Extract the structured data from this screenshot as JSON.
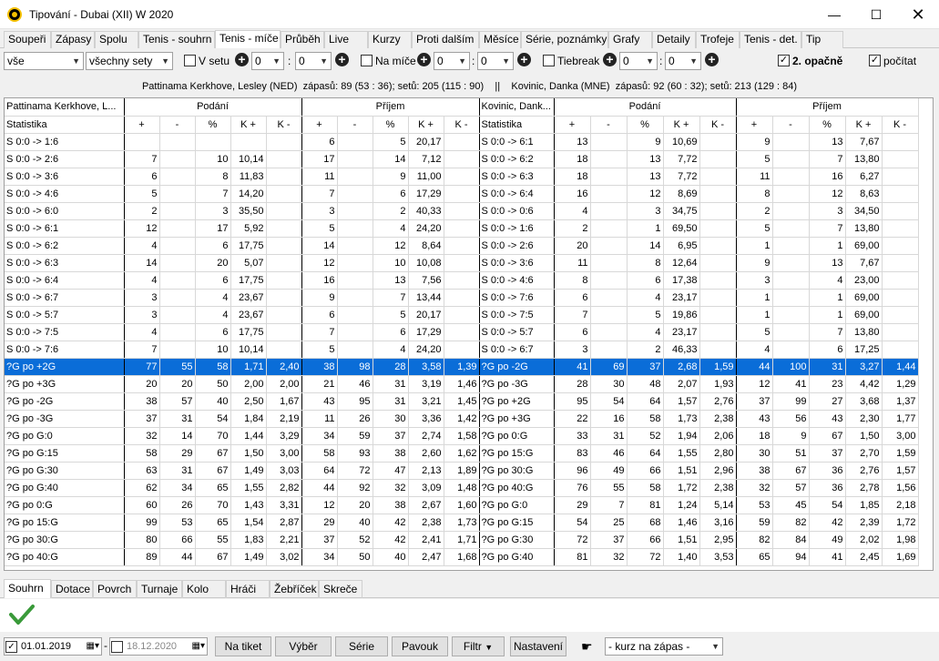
{
  "window": {
    "title": "Tipování - Dubai (XII) W 2020"
  },
  "tabs": [
    "Soupeři",
    "Zápasy",
    "Spolu",
    "Tenis - souhrn",
    "Tenis - míče",
    "Průběh",
    "Live",
    "Kurzy",
    "Proti dalším",
    "Měsíce",
    "Série, poznámky",
    "Grafy",
    "Detaily",
    "Trofeje",
    "Tenis - det.",
    "Tip"
  ],
  "filters": {
    "filter1": "vše",
    "filter2": "všechny sety",
    "v_setu": "V setu",
    "na_mice": "Na míče",
    "tiebreak": "Tiebreak",
    "zero": "0",
    "colon": ":",
    "opacne": "2. opačně",
    "pocitat": "počítat"
  },
  "info": {
    "p1": "Pattinama Kerkhove, Lesley (NED)",
    "p1_stats": "zápasů: 89 (53 : 36);  setů: 205 (115 : 90)",
    "divider": "||",
    "p2": "Kovinic, Danka (MNE)",
    "p2_stats": "zápasů: 92 (60 : 32);  setů: 213 (129 : 84)"
  },
  "grid": {
    "p1_short": "Pattinama Kerkhove, L...",
    "p2_short": "Kovinic, Dank...",
    "stat": "Statistika",
    "podani": "Podání",
    "prijem": "Příjem",
    "sub": [
      "+",
      "-",
      "%",
      "K +",
      "K -"
    ],
    "rows": [
      {
        "l": "S 0:0 -> 1:6",
        "a": [
          "",
          "",
          "",
          "",
          ""
        ],
        "b": [
          "6",
          "",
          "5",
          "20,17",
          ""
        ],
        "l2": "S 0:0 -> 6:1",
        "c": [
          "13",
          "",
          "9",
          "10,69",
          ""
        ],
        "d": [
          "9",
          "",
          "13",
          "7,67",
          ""
        ]
      },
      {
        "l": "S 0:0 -> 2:6",
        "a": [
          "7",
          "",
          "10",
          "10,14",
          ""
        ],
        "b": [
          "17",
          "",
          "14",
          "7,12",
          ""
        ],
        "l2": "S 0:0 -> 6:2",
        "c": [
          "18",
          "",
          "13",
          "7,72",
          ""
        ],
        "d": [
          "5",
          "",
          "7",
          "13,80",
          ""
        ]
      },
      {
        "l": "S 0:0 -> 3:6",
        "a": [
          "6",
          "",
          "8",
          "11,83",
          ""
        ],
        "b": [
          "11",
          "",
          "9",
          "11,00",
          ""
        ],
        "l2": "S 0:0 -> 6:3",
        "c": [
          "18",
          "",
          "13",
          "7,72",
          ""
        ],
        "d": [
          "11",
          "",
          "16",
          "6,27",
          ""
        ]
      },
      {
        "l": "S 0:0 -> 4:6",
        "a": [
          "5",
          "",
          "7",
          "14,20",
          ""
        ],
        "b": [
          "7",
          "",
          "6",
          "17,29",
          ""
        ],
        "l2": "S 0:0 -> 6:4",
        "c": [
          "16",
          "",
          "12",
          "8,69",
          ""
        ],
        "d": [
          "8",
          "",
          "12",
          "8,63",
          ""
        ]
      },
      {
        "l": "S 0:0 -> 6:0",
        "a": [
          "2",
          "",
          "3",
          "35,50",
          ""
        ],
        "b": [
          "3",
          "",
          "2",
          "40,33",
          ""
        ],
        "l2": "S 0:0 -> 0:6",
        "c": [
          "4",
          "",
          "3",
          "34,75",
          ""
        ],
        "d": [
          "2",
          "",
          "3",
          "34,50",
          ""
        ]
      },
      {
        "l": "S 0:0 -> 6:1",
        "a": [
          "12",
          "",
          "17",
          "5,92",
          ""
        ],
        "b": [
          "5",
          "",
          "4",
          "24,20",
          ""
        ],
        "l2": "S 0:0 -> 1:6",
        "c": [
          "2",
          "",
          "1",
          "69,50",
          ""
        ],
        "d": [
          "5",
          "",
          "7",
          "13,80",
          ""
        ]
      },
      {
        "l": "S 0:0 -> 6:2",
        "a": [
          "4",
          "",
          "6",
          "17,75",
          ""
        ],
        "b": [
          "14",
          "",
          "12",
          "8,64",
          ""
        ],
        "l2": "S 0:0 -> 2:6",
        "c": [
          "20",
          "",
          "14",
          "6,95",
          ""
        ],
        "d": [
          "1",
          "",
          "1",
          "69,00",
          ""
        ]
      },
      {
        "l": "S 0:0 -> 6:3",
        "a": [
          "14",
          "",
          "20",
          "5,07",
          ""
        ],
        "b": [
          "12",
          "",
          "10",
          "10,08",
          ""
        ],
        "l2": "S 0:0 -> 3:6",
        "c": [
          "11",
          "",
          "8",
          "12,64",
          ""
        ],
        "d": [
          "9",
          "",
          "13",
          "7,67",
          ""
        ]
      },
      {
        "l": "S 0:0 -> 6:4",
        "a": [
          "4",
          "",
          "6",
          "17,75",
          ""
        ],
        "b": [
          "16",
          "",
          "13",
          "7,56",
          ""
        ],
        "l2": "S 0:0 -> 4:6",
        "c": [
          "8",
          "",
          "6",
          "17,38",
          ""
        ],
        "d": [
          "3",
          "",
          "4",
          "23,00",
          ""
        ]
      },
      {
        "l": "S 0:0 -> 6:7",
        "a": [
          "3",
          "",
          "4",
          "23,67",
          ""
        ],
        "b": [
          "9",
          "",
          "7",
          "13,44",
          ""
        ],
        "l2": "S 0:0 -> 7:6",
        "c": [
          "6",
          "",
          "4",
          "23,17",
          ""
        ],
        "d": [
          "1",
          "",
          "1",
          "69,00",
          ""
        ]
      },
      {
        "l": "S 0:0 -> 5:7",
        "a": [
          "3",
          "",
          "4",
          "23,67",
          ""
        ],
        "b": [
          "6",
          "",
          "5",
          "20,17",
          ""
        ],
        "l2": "S 0:0 -> 7:5",
        "c": [
          "7",
          "",
          "5",
          "19,86",
          ""
        ],
        "d": [
          "1",
          "",
          "1",
          "69,00",
          ""
        ]
      },
      {
        "l": "S 0:0 -> 7:5",
        "a": [
          "4",
          "",
          "6",
          "17,75",
          ""
        ],
        "b": [
          "7",
          "",
          "6",
          "17,29",
          ""
        ],
        "l2": "S 0:0 -> 5:7",
        "c": [
          "6",
          "",
          "4",
          "23,17",
          ""
        ],
        "d": [
          "5",
          "",
          "7",
          "13,80",
          ""
        ]
      },
      {
        "l": "S 0:0 -> 7:6",
        "a": [
          "7",
          "",
          "10",
          "10,14",
          ""
        ],
        "b": [
          "5",
          "",
          "4",
          "24,20",
          ""
        ],
        "l2": "S 0:0 -> 6:7",
        "c": [
          "3",
          "",
          "2",
          "46,33",
          ""
        ],
        "d": [
          "4",
          "",
          "6",
          "17,25",
          ""
        ]
      },
      {
        "l": "?G po +2G",
        "a": [
          "77",
          "55",
          "58",
          "1,71",
          "2,40"
        ],
        "b": [
          "38",
          "98",
          "28",
          "3,58",
          "1,39"
        ],
        "l2": "?G po -2G",
        "c": [
          "41",
          "69",
          "37",
          "2,68",
          "1,59"
        ],
        "d": [
          "44",
          "100",
          "31",
          "3,27",
          "1,44"
        ],
        "sel": true
      },
      {
        "l": "?G po +3G",
        "a": [
          "20",
          "20",
          "50",
          "2,00",
          "2,00"
        ],
        "b": [
          "21",
          "46",
          "31",
          "3,19",
          "1,46"
        ],
        "l2": "?G po -3G",
        "c": [
          "28",
          "30",
          "48",
          "2,07",
          "1,93"
        ],
        "d": [
          "12",
          "41",
          "23",
          "4,42",
          "1,29"
        ]
      },
      {
        "l": "?G po -2G",
        "a": [
          "38",
          "57",
          "40",
          "2,50",
          "1,67"
        ],
        "b": [
          "43",
          "95",
          "31",
          "3,21",
          "1,45"
        ],
        "l2": "?G po +2G",
        "c": [
          "95",
          "54",
          "64",
          "1,57",
          "2,76"
        ],
        "d": [
          "37",
          "99",
          "27",
          "3,68",
          "1,37"
        ]
      },
      {
        "l": "?G po -3G",
        "a": [
          "37",
          "31",
          "54",
          "1,84",
          "2,19"
        ],
        "b": [
          "11",
          "26",
          "30",
          "3,36",
          "1,42"
        ],
        "l2": "?G po +3G",
        "c": [
          "22",
          "16",
          "58",
          "1,73",
          "2,38"
        ],
        "d": [
          "43",
          "56",
          "43",
          "2,30",
          "1,77"
        ]
      },
      {
        "l": "?G po G:0",
        "a": [
          "32",
          "14",
          "70",
          "1,44",
          "3,29"
        ],
        "b": [
          "34",
          "59",
          "37",
          "2,74",
          "1,58"
        ],
        "l2": "?G po 0:G",
        "c": [
          "33",
          "31",
          "52",
          "1,94",
          "2,06"
        ],
        "d": [
          "18",
          "9",
          "67",
          "1,50",
          "3,00"
        ]
      },
      {
        "l": "?G po G:15",
        "a": [
          "58",
          "29",
          "67",
          "1,50",
          "3,00"
        ],
        "b": [
          "58",
          "93",
          "38",
          "2,60",
          "1,62"
        ],
        "l2": "?G po 15:G",
        "c": [
          "83",
          "46",
          "64",
          "1,55",
          "2,80"
        ],
        "d": [
          "30",
          "51",
          "37",
          "2,70",
          "1,59"
        ]
      },
      {
        "l": "?G po G:30",
        "a": [
          "63",
          "31",
          "67",
          "1,49",
          "3,03"
        ],
        "b": [
          "64",
          "72",
          "47",
          "2,13",
          "1,89"
        ],
        "l2": "?G po 30:G",
        "c": [
          "96",
          "49",
          "66",
          "1,51",
          "2,96"
        ],
        "d": [
          "38",
          "67",
          "36",
          "2,76",
          "1,57"
        ]
      },
      {
        "l": "?G po G:40",
        "a": [
          "62",
          "34",
          "65",
          "1,55",
          "2,82"
        ],
        "b": [
          "44",
          "92",
          "32",
          "3,09",
          "1,48"
        ],
        "l2": "?G po 40:G",
        "c": [
          "76",
          "55",
          "58",
          "1,72",
          "2,38"
        ],
        "d": [
          "32",
          "57",
          "36",
          "2,78",
          "1,56"
        ]
      },
      {
        "l": "?G po 0:G",
        "a": [
          "60",
          "26",
          "70",
          "1,43",
          "3,31"
        ],
        "b": [
          "12",
          "20",
          "38",
          "2,67",
          "1,60"
        ],
        "l2": "?G po G:0",
        "c": [
          "29",
          "7",
          "81",
          "1,24",
          "5,14"
        ],
        "d": [
          "53",
          "45",
          "54",
          "1,85",
          "2,18"
        ]
      },
      {
        "l": "?G po 15:G",
        "a": [
          "99",
          "53",
          "65",
          "1,54",
          "2,87"
        ],
        "b": [
          "29",
          "40",
          "42",
          "2,38",
          "1,73"
        ],
        "l2": "?G po G:15",
        "c": [
          "54",
          "25",
          "68",
          "1,46",
          "3,16"
        ],
        "d": [
          "59",
          "82",
          "42",
          "2,39",
          "1,72"
        ]
      },
      {
        "l": "?G po 30:G",
        "a": [
          "80",
          "66",
          "55",
          "1,83",
          "2,21"
        ],
        "b": [
          "37",
          "52",
          "42",
          "2,41",
          "1,71"
        ],
        "l2": "?G po G:30",
        "c": [
          "72",
          "37",
          "66",
          "1,51",
          "2,95"
        ],
        "d": [
          "82",
          "84",
          "49",
          "2,02",
          "1,98"
        ]
      },
      {
        "l": "?G po 40:G",
        "a": [
          "89",
          "44",
          "67",
          "1,49",
          "3,02"
        ],
        "b": [
          "34",
          "50",
          "40",
          "2,47",
          "1,68"
        ],
        "l2": "?G po G:40",
        "c": [
          "81",
          "32",
          "72",
          "1,40",
          "3,53"
        ],
        "d": [
          "65",
          "94",
          "41",
          "2,45",
          "1,69"
        ]
      }
    ]
  },
  "bottom_tabs": [
    "Souhrn",
    "Dotace",
    "Povrch",
    "Turnaje",
    "Kolo",
    "Hráči",
    "Žebříček",
    "Skreče"
  ],
  "bottom": {
    "date_from": "01.01.2019",
    "dash": "-",
    "date_to": "18.12.2020",
    "na_tiket": "Na tiket",
    "vyber": "Výběr",
    "serie": "Série",
    "pavouk": "Pavouk",
    "filtr": "Filtr",
    "nastaveni": "Nastavení",
    "kurz": "- kurz na zápas -"
  }
}
